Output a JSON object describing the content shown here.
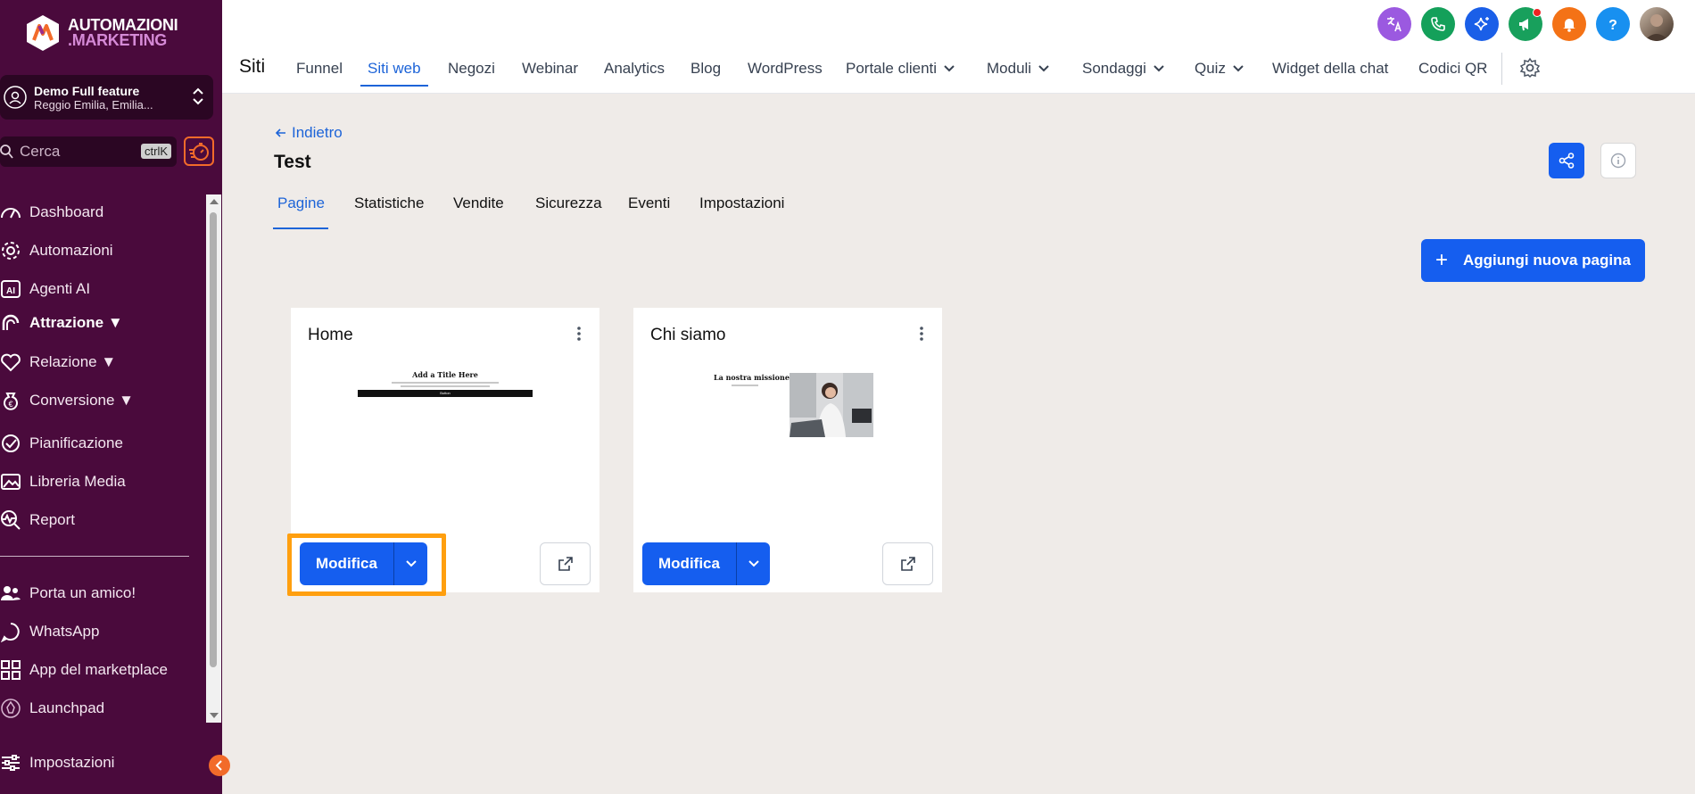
{
  "brand": {
    "line1": "AUTOMAZIONI",
    "line2": ".MARKETING"
  },
  "account": {
    "name": "Demo Full feature",
    "location": "Reggio Emilia, Emilia..."
  },
  "search": {
    "placeholder": "Cerca",
    "shortcut": "ctrlK"
  },
  "sidebar": {
    "items": [
      {
        "label": "Dashboard",
        "icon": "dashboard-icon"
      },
      {
        "label": "Automazioni",
        "icon": "gear-icon"
      },
      {
        "label": "Agenti AI",
        "icon": "ai-icon"
      },
      {
        "label": "Attrazione ▼",
        "icon": "magnet-icon"
      },
      {
        "label": "Relazione ▼",
        "icon": "heart-icon"
      },
      {
        "label": "Conversione ▼",
        "icon": "money-bag-icon"
      },
      {
        "label": "Pianificazione",
        "icon": "check-circle-icon"
      },
      {
        "label": "Libreria Media",
        "icon": "image-icon"
      },
      {
        "label": "Report",
        "icon": "report-icon"
      }
    ],
    "secondary": [
      {
        "label": "Porta un amico!",
        "icon": "users-icon"
      },
      {
        "label": "WhatsApp",
        "icon": "whatsapp-icon"
      },
      {
        "label": "App del marketplace",
        "icon": "grid-icon"
      },
      {
        "label": "Launchpad",
        "icon": "launchpad-icon"
      }
    ],
    "settings_label": "Impostazioni"
  },
  "topbar": {
    "section": "Siti",
    "tabs": [
      "Funnel",
      "Siti web",
      "Negozi",
      "Webinar",
      "Analytics",
      "Blog",
      "WordPress",
      "Portale clienti",
      "Moduli",
      "Sondaggi",
      "Quiz",
      "Widget della chat",
      "Codici QR"
    ],
    "active_tab": "Siti web",
    "icon_colors": {
      "translate": "#9b59e0",
      "phone": "#14a05a",
      "ai": "#1a5fe8",
      "megaphone": "#18a05c",
      "bell": "#f47216",
      "help": "#1890f0"
    }
  },
  "page": {
    "back_label": "Indietro",
    "title": "Test",
    "subtabs": [
      "Pagine",
      "Statistiche",
      "Vendite",
      "Sicurezza",
      "Eventi",
      "Impostazioni"
    ],
    "active_subtab": "Pagine",
    "add_button": "Aggiungi nuova pagina"
  },
  "cards": [
    {
      "title": "Home",
      "preview_heading": "Add a Title Here",
      "preview_button": "Button",
      "edit_label": "Modifica"
    },
    {
      "title": "Chi siamo",
      "preview_heading": "La nostra missione",
      "edit_label": "Modifica"
    }
  ],
  "colors": {
    "sidebar": "#4a0a3c",
    "primary": "#155eef",
    "highlight": "#ff9f0f",
    "accent": "#f26b2a"
  }
}
